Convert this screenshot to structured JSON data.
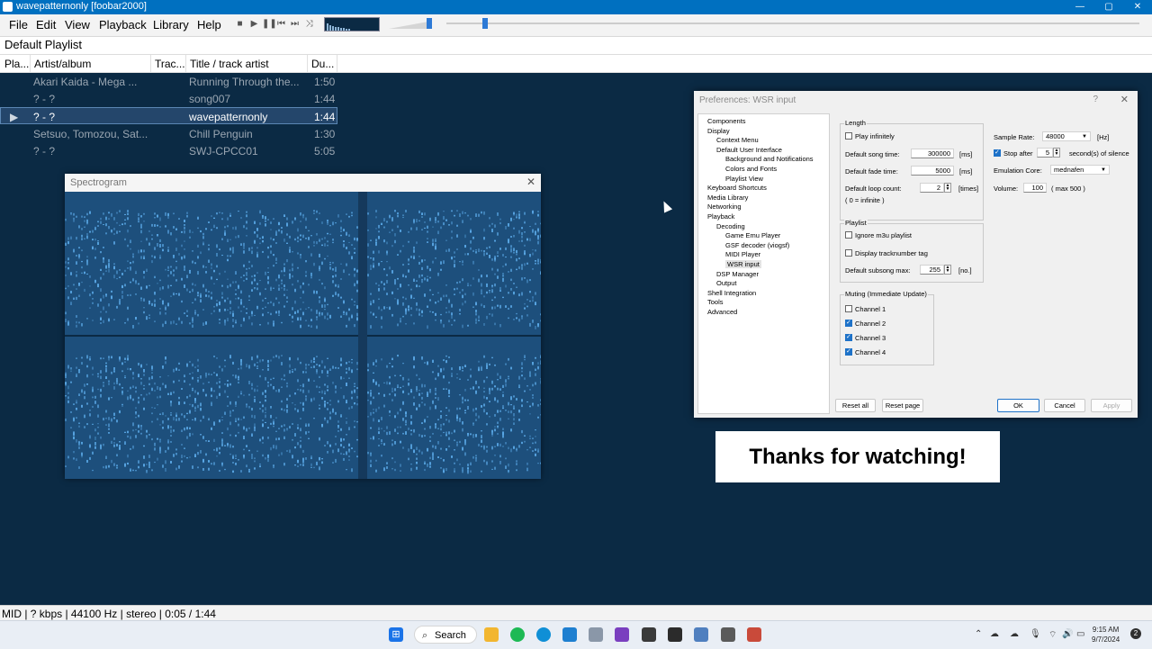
{
  "window": {
    "title": "wavepatternonly  [foobar2000]",
    "minimize": "—",
    "maximize": "▢",
    "close": "✕"
  },
  "menu": [
    "File",
    "Edit",
    "View",
    "Playback",
    "Library",
    "Help"
  ],
  "toolbar": {
    "stop": "■",
    "play": "▶",
    "pause": "❚❚",
    "prev": "⏮",
    "next": "⏭",
    "random": "⤨"
  },
  "playlist": {
    "tab": "Default Playlist",
    "columns": [
      "Pla...",
      "Artist/album",
      "Trac...",
      "Title / track artist",
      "Du..."
    ],
    "rows": [
      {
        "playing": "",
        "artist": "Akari Kaida - Mega ...",
        "track": "",
        "title": "Running Through the...",
        "duration": "1:50"
      },
      {
        "playing": "",
        "artist": "? - ?",
        "track": "",
        "title": "song007",
        "duration": "1:44"
      },
      {
        "playing": "▶",
        "artist": "? - ?",
        "track": "",
        "title": "wavepatternonly",
        "duration": "1:44"
      },
      {
        "playing": "",
        "artist": "Setsuo, Tomozou, Sat...",
        "track": "",
        "title": "Chill Penguin",
        "duration": "1:30"
      },
      {
        "playing": "",
        "artist": "? - ?",
        "track": "",
        "title": "SWJ-CPCC01",
        "duration": "5:05"
      }
    ]
  },
  "spectrogram": {
    "title": "Spectrogram",
    "close": "✕"
  },
  "prefs": {
    "title": "Preferences: WSR input",
    "help": "?",
    "close": "✕",
    "tree": [
      {
        "label": "Components",
        "level": 0,
        "sel": false
      },
      {
        "label": "Display",
        "level": 0,
        "sel": false
      },
      {
        "label": "Context Menu",
        "level": 1,
        "sel": false
      },
      {
        "label": "Default User Interface",
        "level": 1,
        "sel": false
      },
      {
        "label": "Background and Notifications",
        "level": 2,
        "sel": false
      },
      {
        "label": "Colors and Fonts",
        "level": 2,
        "sel": false
      },
      {
        "label": "Playlist View",
        "level": 2,
        "sel": false
      },
      {
        "label": "Keyboard Shortcuts",
        "level": 0,
        "sel": false
      },
      {
        "label": "Media Library",
        "level": 0,
        "sel": false
      },
      {
        "label": "Networking",
        "level": 0,
        "sel": false
      },
      {
        "label": "Playback",
        "level": 0,
        "sel": false
      },
      {
        "label": "Decoding",
        "level": 1,
        "sel": false
      },
      {
        "label": "Game Emu Player",
        "level": 2,
        "sel": false
      },
      {
        "label": "GSF decoder (viogsf)",
        "level": 2,
        "sel": false
      },
      {
        "label": "MIDI Player",
        "level": 2,
        "sel": false
      },
      {
        "label": "WSR input",
        "level": 2,
        "sel": true
      },
      {
        "label": "DSP Manager",
        "level": 1,
        "sel": false
      },
      {
        "label": "Output",
        "level": 1,
        "sel": false
      },
      {
        "label": "Shell Integration",
        "level": 0,
        "sel": false
      },
      {
        "label": "Tools",
        "level": 0,
        "sel": false
      },
      {
        "label": "Advanced",
        "level": 0,
        "sel": false
      }
    ],
    "length": {
      "group": "Length",
      "play_infinitely": "Play infinitely",
      "song_time_label": "Default song time:",
      "song_time": "300000",
      "song_time_unit": "[ms]",
      "fade_time_label": "Default fade time:",
      "fade_time": "5000",
      "fade_time_unit": "[ms]",
      "loop_label": "Default loop count:",
      "loop": "2",
      "loop_unit": "[times]",
      "infinite_note": "( 0 = infinite )"
    },
    "playlist": {
      "group": "Playlist",
      "ignore_m3u": "Ignore m3u playlist",
      "display_track": "Display tracknumber tag",
      "subsong_label": "Default subsong max:",
      "subsong": "255",
      "subsong_unit": "[no.]"
    },
    "muting": {
      "group": "Muting (Immediate Update)",
      "channels": [
        {
          "label": "Channel 1",
          "checked": false
        },
        {
          "label": "Channel 2",
          "checked": true
        },
        {
          "label": "Channel 3",
          "checked": true
        },
        {
          "label": "Channel 4",
          "checked": true
        }
      ]
    },
    "right": {
      "sample_rate_label": "Sample Rate:",
      "sample_rate": "48000",
      "sample_rate_unit": "[Hz]",
      "stop_after_label": "Stop after",
      "stop_after": "5",
      "stop_after_unit": "second(s) of silence",
      "emu_core_label": "Emulation Core:",
      "emu_core": "mednafen",
      "volume_label": "Volume:",
      "volume": "100",
      "volume_max": "( max 500 )"
    },
    "buttons": {
      "reset_all": "Reset all",
      "reset_page": "Reset page",
      "ok": "OK",
      "cancel": "Cancel",
      "apply": "Apply"
    }
  },
  "overlay": {
    "thanks": "Thanks for watching!"
  },
  "status": "MID | ? kbps | 44100 Hz | stereo | 0:05 / 1:44",
  "taskbar": {
    "search": "Search",
    "time": "9:15 AM",
    "date": "9/7/2024",
    "badge": "2"
  },
  "colors": {
    "background": "#0b2a44",
    "accent": "#0070c0",
    "spectrum": "#5aa8e6"
  }
}
